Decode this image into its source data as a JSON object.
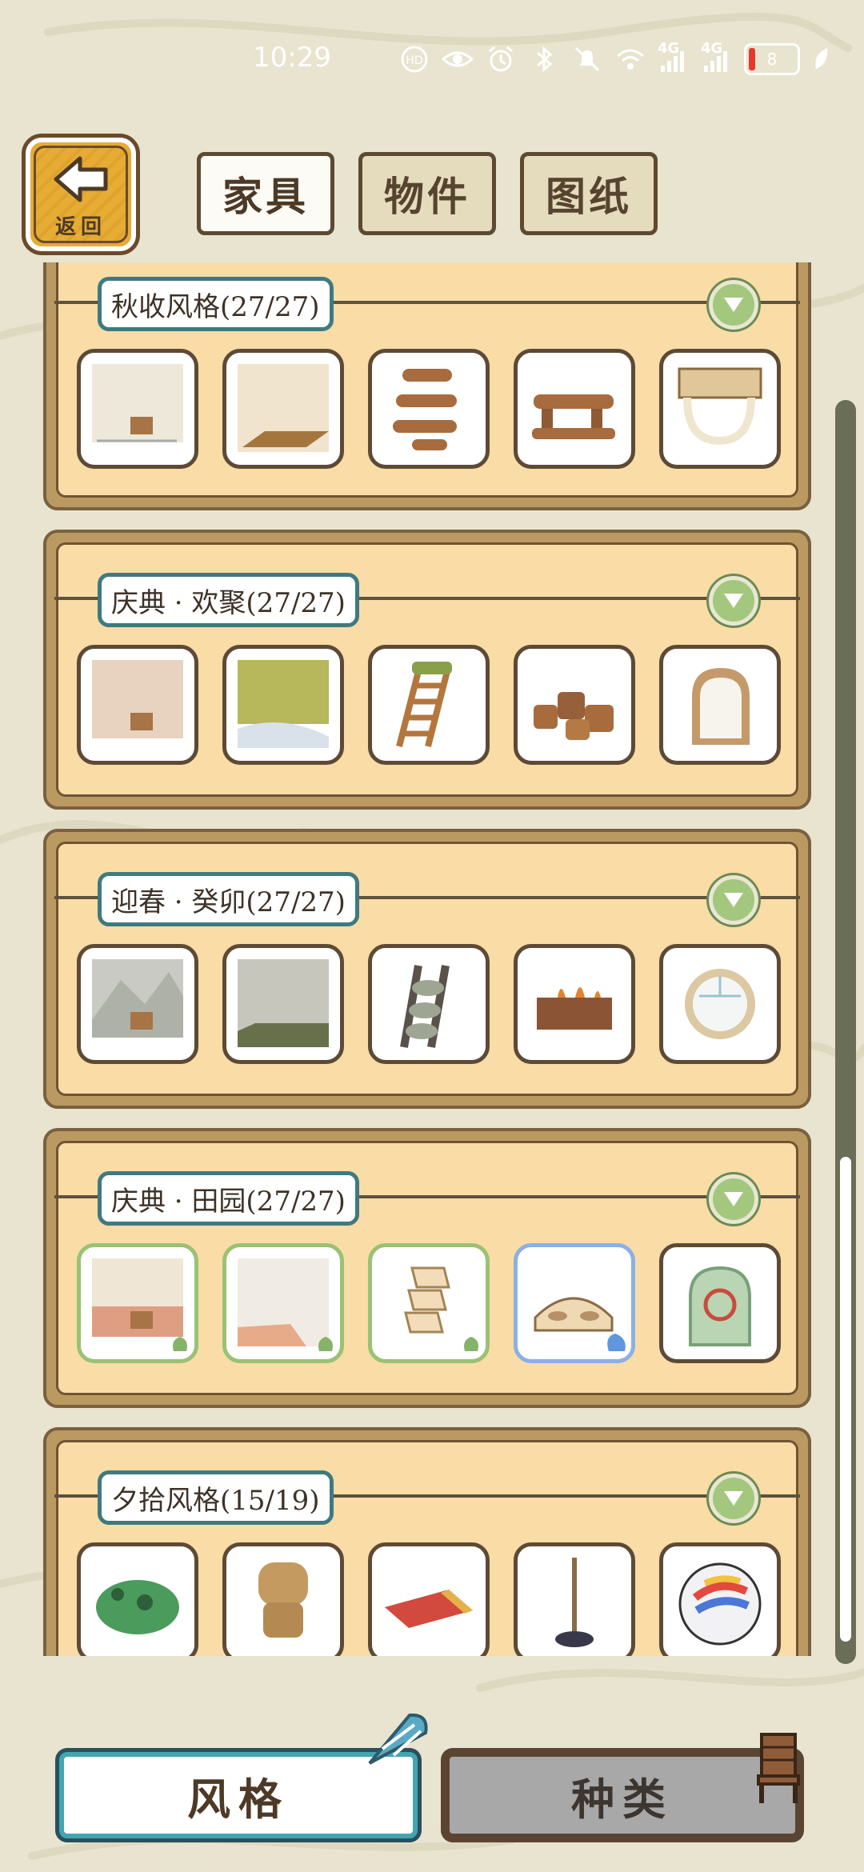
{
  "status": {
    "time": "10:29",
    "network_1": "4G",
    "network_2": "4G",
    "battery": "8"
  },
  "back": {
    "label": "返回",
    "icon": "back-arrow-icon"
  },
  "tabs": [
    {
      "label": "家具",
      "active": true
    },
    {
      "label": "物件",
      "active": false
    },
    {
      "label": "图纸",
      "active": false
    }
  ],
  "groups": [
    {
      "title": "秋收风格(27/27)"
    },
    {
      "title": "庆典 · 欢聚(27/27)"
    },
    {
      "title": "迎春 · 癸卯(27/27)"
    },
    {
      "title": "庆典 · 田园(27/27)"
    },
    {
      "title": "夕拾风格(15/19)"
    }
  ],
  "bottom": {
    "style_label": "风格",
    "type_label": "种类"
  },
  "colors": {
    "accent_teal": "#43a5b0",
    "panel": "#f9dca6",
    "frame": "#bb9a62",
    "green_toggle": "#a4c77e"
  }
}
